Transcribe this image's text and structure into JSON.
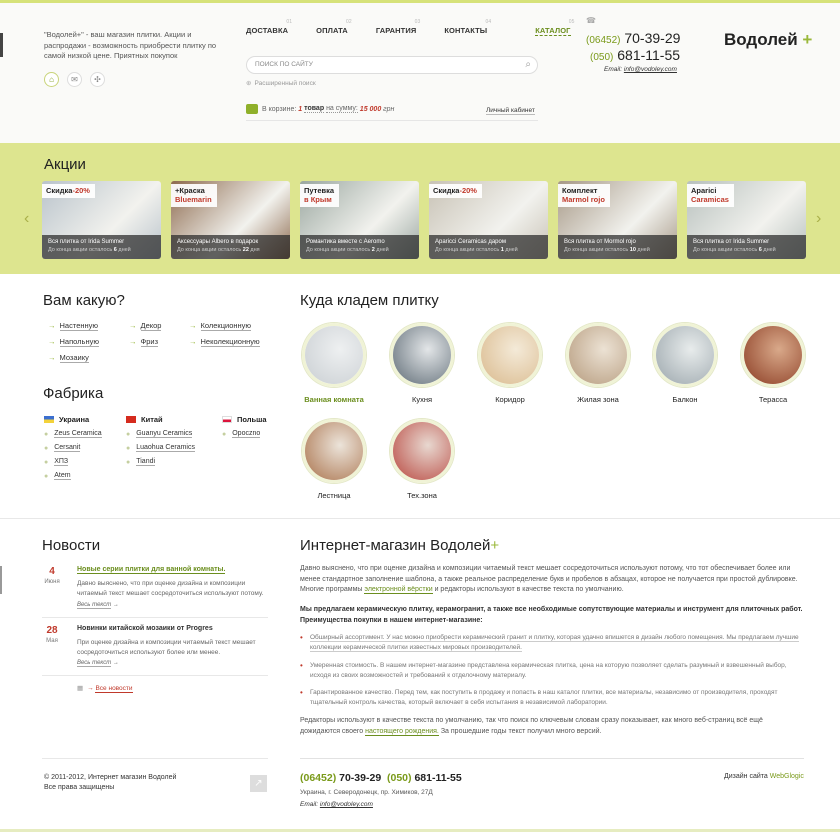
{
  "header": {
    "tagline": "\"Водолей+\" - ваш магазин плитки. Акции и распродажи - возможность приобрести плитку по самой низкой цене. Приятных покупок",
    "nav": [
      {
        "label": "Доставка",
        "num": "01"
      },
      {
        "label": "Оплата",
        "num": "02"
      },
      {
        "label": "Гарантия",
        "num": "03"
      },
      {
        "label": "Контакты",
        "num": "04"
      },
      {
        "label": "Каталог",
        "num": "05"
      }
    ],
    "search_placeholder": "Поиск по сайту",
    "advanced_search": "Расширенный поиск",
    "cart": {
      "prefix": "В корзине:",
      "count": "1",
      "count_word": "товар",
      "mid": "на сумму:",
      "sum": "15 000",
      "currency": "грн"
    },
    "cabinet": "Личный кабинет",
    "phone1_code": "(06452)",
    "phone1": "70-39-29",
    "phone2_code": "(050)",
    "phone2": "681-11-55",
    "email_label": "Email:",
    "email": "info@vodoley.com",
    "logo": "Водолей",
    "logo_plus": "+"
  },
  "promo": {
    "title": "Акции",
    "cards": [
      {
        "ribbon": "Скидка",
        "ribbon_hl": "-20%",
        "ribbon2": "",
        "text": "Вся плитка от Irida Summer",
        "left_pre": "До конца акции осталось",
        "left": "6",
        "left_post": "дней",
        "bg": "#b9c3cb"
      },
      {
        "ribbon": "+Краска",
        "ribbon_hl": "",
        "ribbon2": "Bluemarin",
        "text": "Аксессуары Albero в подарок",
        "left_pre": "До конца акции осталось",
        "left": "22",
        "left_post": "дня",
        "bg": "#8d6a4e"
      },
      {
        "ribbon": "Путевка",
        "ribbon_hl": "",
        "ribbon2": "в Крым",
        "text": "Романтика вместе с Aeromo",
        "left_pre": "До конца акции осталось",
        "left": "2",
        "left_post": "дней",
        "bg": "#9aa7a0"
      },
      {
        "ribbon": "Скидка",
        "ribbon_hl": "-20%",
        "ribbon2": "",
        "text": "Aparicci Ceramicas даром",
        "left_pre": "До конца акции осталось",
        "left": "1",
        "left_post": "дней",
        "bg": "#c8c2b5"
      },
      {
        "ribbon": "Комплект",
        "ribbon_hl": "",
        "ribbon2": "Marmol rojo",
        "text": "Вся плитка от Mormol rojo",
        "left_pre": "До конца акции осталось",
        "left": "10",
        "left_post": "дней",
        "bg": "#a69886"
      },
      {
        "ribbon": "Aparici",
        "ribbon_hl": "",
        "ribbon2": "Caramicas",
        "text": "Вся плитка от Irida Summer",
        "left_pre": "До конца акции осталось",
        "left": "6",
        "left_post": "дней",
        "bg": "#b7c0bd"
      }
    ]
  },
  "which": {
    "title": "Вам какую?",
    "links": [
      "Настенную",
      "Напольную",
      "Мозаику",
      "Декор",
      "Фриз",
      "Колекционную",
      "Неколекционную"
    ]
  },
  "factory": {
    "title": "Фабрика",
    "columns": [
      {
        "country": "Украина",
        "items": [
          "Zeus Ceramica",
          "Cersanit",
          "ХПЗ",
          "Atem"
        ]
      },
      {
        "country": "Китай",
        "items": [
          "Guanyu Ceramics",
          "Luaohua Ceramics",
          "Tiandi"
        ]
      },
      {
        "country": "Польша",
        "items": [
          "Opoczno"
        ]
      }
    ]
  },
  "rooms": {
    "title": "Куда кладем плитку",
    "items": [
      "Ванная комната",
      "Кухня",
      "Коридор",
      "Жилая зона",
      "Балкон",
      "Терасса",
      "Лестница",
      "Тех.зона"
    ]
  },
  "news": {
    "title": "Новости",
    "items": [
      {
        "day": "4",
        "month": "Июня",
        "title": "Новые серии плитки для ванной комнаты.",
        "body": "Давно выяснено, что при оценке дизайна и композиции читаемый текст мешает сосредоточиться используют потому.",
        "more": "Весь текст"
      },
      {
        "day": "28",
        "month": "Мая",
        "title": "Новинки китайской мозаики от Progres",
        "body": "При оценке дизайна и композиции читаемый текст мешает сосредоточиться используют более или менее.",
        "more": "Весь текст"
      }
    ],
    "all": "Все новости"
  },
  "about": {
    "title": "Интернет-магазин Водолей",
    "plus": "+",
    "p1_a": "Давно выяснено, что при оценке дизайна и композиции читаемый текст мешает сосредоточиться используют потому, что тот обеспечивает более или менее стандартное заполнение шаблона, а также реальное распределение букв и пробелов в абзацах, которое не получается при простой дублировке. Многие программы",
    "p1_link": "электронной вёрстки",
    "p1_b": "и редакторы используют в качестве текста по умолчанию.",
    "p2": "Мы предлагаем керамическую плитку, керамогранит, а также все необходимые сопутствующие материалы и инструмент для плиточных работ. Преимущества покупки в нашем интернет-магазине:",
    "bullets": [
      "Обширный ассортимент. У нас можно приобрести керамический гранит и плитку, которая удачно впишется в дизайн любого помещения. Мы предлагаем лучшие коллекции керамической плитки известных мировых производителей.",
      "Умеренная стоимость. В нашем интернет-магазине представлена керамическая плитка, цена на которую позволяет сделать разумный и взвешенный выбор, исходя из своих возможностей и требований к отделочному материалу.",
      "Гарантированное качество. Перед тем, как поступить в продажу и попасть в наш каталог плитки, все материалы, независимо от производителя, проходят тщательный контроль качества, который включает в себя испытания в независимой лаборатории."
    ],
    "p3_a": "Редакторы используют в качестве текста по умолчанию, так что поиск по ключевым словам сразу показывает, как много веб-страниц всё ещё дожидаются своего",
    "p3_link": "настоящего рождения.",
    "p3_b": "За прошедшие годы текст получил много версий."
  },
  "footer": {
    "copy1": "© 2011-2012, Интернет магазин Водолей",
    "copy2": "Все права защищены",
    "phone1_code": "(06452)",
    "phone1": "70-39-29",
    "phone2_code": "(050)",
    "phone2": "681-11-55",
    "address": "Украина, г. Северодонецк, пр. Химиков, 27Д",
    "email_label": "Email:",
    "email": "info@vodoley.com",
    "design_label": "Дизайн сайта",
    "design_by": "WebGlogic"
  },
  "colors": {
    "accent_green": "#7a9a1a",
    "promo_bg": "#dde58f",
    "red": "#c0392b"
  }
}
